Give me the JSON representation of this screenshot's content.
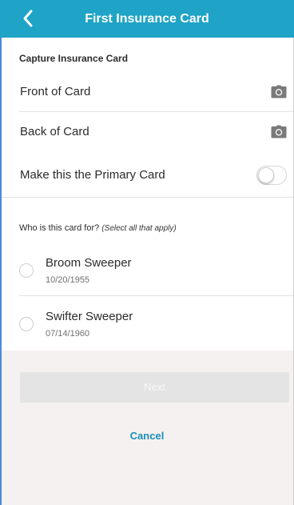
{
  "header": {
    "title": "First Insurance Card",
    "back_icon": "chevron-left-icon"
  },
  "capture": {
    "section_label": "Capture Insurance Card",
    "front_label": "Front of Card",
    "back_label": "Back of Card",
    "camera_icon": "camera-icon"
  },
  "primary": {
    "label": "Make this the Primary Card",
    "enabled": false
  },
  "recipients": {
    "question": "Who is this card for?",
    "hint": "(Select all that apply)",
    "people": [
      {
        "name": "Broom Sweeper",
        "dob": "10/20/1955",
        "selected": false
      },
      {
        "name": "Swifter Sweeper",
        "dob": "07/14/1960",
        "selected": false
      }
    ]
  },
  "actions": {
    "next_label": "Next",
    "cancel_label": "Cancel"
  },
  "colors": {
    "header": "#1fa3c6",
    "accent": "#1a8fb5"
  }
}
